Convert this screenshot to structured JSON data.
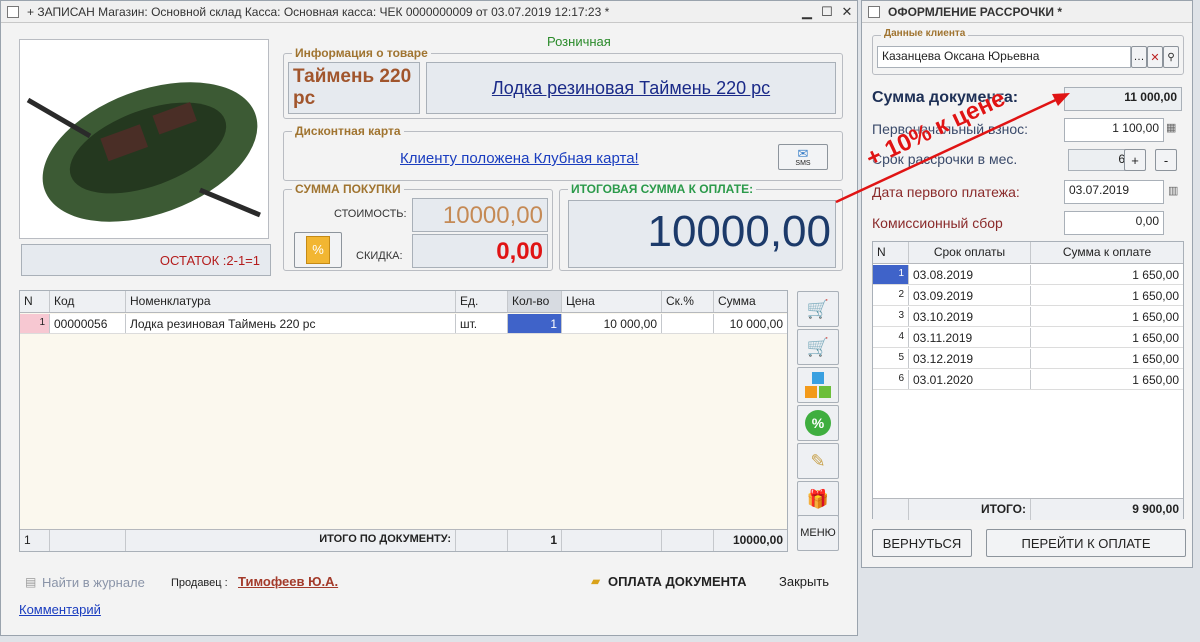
{
  "main": {
    "title": "+ ЗАПИСАН Магазин: Основной склад Касса: Основная касса: ЧЕК 0000000009 от 03.07.2019 12:17:23 *",
    "price_type": "Розничная",
    "product_info_title": "Информация о товаре",
    "product_short": "Таймень 220 рс",
    "product_full": "Лодка резиновая Таймень 220 рс",
    "stock": "ОСТАТОК :2-1=1",
    "discount_card_title": "Дисконтная карта",
    "discount_card_msg": "Клиенту положена Клубная карта!",
    "sms": "SMS",
    "purchase_title": "СУММА ПОКУПКИ",
    "cost_label": "СТОИМОСТЬ:",
    "cost_value": "10000,00",
    "discount_label": "СКИДКА:",
    "discount_value": "0,00",
    "total_title": "ИТОГОВАЯ СУММА К ОПЛАТЕ:",
    "total_value": "10000,00",
    "table": {
      "headers": [
        "N",
        "Код",
        "Номенклатура",
        "Ед.",
        "Кол-во",
        "Цена",
        "Ск.%",
        "Сумма"
      ],
      "rows": [
        [
          "1",
          "00000056",
          "Лодка резиновая Таймень 220 рс",
          "шт.",
          "1",
          "10 000,00",
          "",
          "10 000,00"
        ]
      ],
      "footer": [
        "1",
        "",
        "ИТОГО ПО ДОКУМЕНТУ:",
        "",
        "1",
        "",
        "",
        "10000,00"
      ]
    },
    "menu_label": "МЕНЮ",
    "find_journal": "Найти в журнале",
    "seller_label": "Продавец :",
    "seller_name": "Тимофеев Ю.А.",
    "pay_doc": "ОПЛАТА ДОКУМЕНТА",
    "close": "Закрыть",
    "comment": "Комментарий"
  },
  "installment": {
    "title": "ОФОРМЛЕНИЕ РАССРОЧКИ *",
    "client_group": "Данные клиента",
    "client_name": "Казанцева Оксана Юрьевна",
    "doc_sum_label": "Сумма документа:",
    "doc_sum_value": "11 000,00",
    "first_payment_label": "Первоначальный взнос:",
    "first_payment_value": "1 100,00",
    "term_label": "Срок рассрочки в мес.",
    "term_value": "6",
    "first_date_label": "Дата первого платежа:",
    "first_date_value": "03.07.2019",
    "fee_label": "Комиссионный сбор",
    "fee_value": "0,00",
    "schedule_headers": [
      "N",
      "Срок оплаты",
      "Сумма к  оплате"
    ],
    "schedule": [
      [
        "1",
        "03.08.2019",
        "1 650,00"
      ],
      [
        "2",
        "03.09.2019",
        "1 650,00"
      ],
      [
        "3",
        "03.10.2019",
        "1 650,00"
      ],
      [
        "4",
        "03.11.2019",
        "1 650,00"
      ],
      [
        "5",
        "03.12.2019",
        "1 650,00"
      ],
      [
        "6",
        "03.01.2020",
        "1 650,00"
      ]
    ],
    "total_label": "ИТОГО:",
    "total_value": "9 900,00",
    "back_button": "ВЕРНУТЬСЯ",
    "pay_button": "ПЕРЕЙТИ К ОПЛАТЕ"
  },
  "annotation": "+ 10% к цене"
}
